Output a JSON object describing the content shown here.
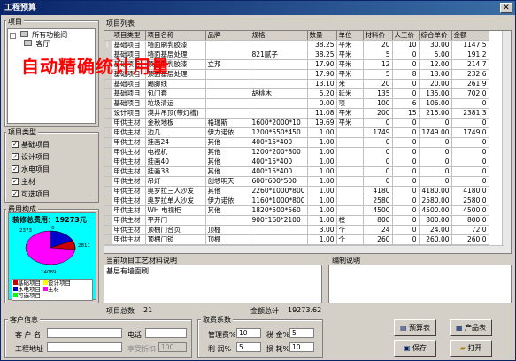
{
  "window": {
    "title": "工程预算",
    "close_glyph": "✕"
  },
  "left": {
    "tree_header": "项目",
    "tree_items": [
      "所有功能间",
      "客厅"
    ],
    "types_header": "项目类型",
    "types": [
      {
        "label": "基础项目",
        "checked": true
      },
      {
        "label": "设计项目",
        "checked": true
      },
      {
        "label": "水电项目",
        "checked": true
      },
      {
        "label": "主材",
        "checked": true
      },
      {
        "label": "可选项目",
        "checked": true
      }
    ],
    "cost_header": "费用构成",
    "total_label": "装修总费用：19273元",
    "pie_values": [
      "2373",
      "0",
      "2811",
      "14089"
    ],
    "legend": [
      "基础项目",
      "设计项目",
      "水电项目",
      "主材",
      "可选项目"
    ],
    "colors": {
      "base": "#cc0000",
      "design": "#ffff00",
      "water": "#0000cc",
      "main": "#ff00ff",
      "optional": "#00ff00"
    }
  },
  "overlay_text": "自动精确统计用量",
  "list": {
    "header": "项目列表",
    "columns": [
      "项目类型",
      "项目名称",
      "品牌",
      "规格",
      "数量",
      "单位",
      "材料价",
      "人工价",
      "综合单价",
      "金额"
    ],
    "rows": [
      [
        "基础项目",
        "墙面刷乳胶漆",
        "",
        "",
        "38.25",
        "平米",
        "20",
        "10",
        "30.00",
        "1147.5"
      ],
      [
        "基础项目",
        "墙面基层处理",
        "",
        "821腻子",
        "38.25",
        "平米",
        "5",
        "0",
        "5.00",
        "191.2"
      ],
      [
        "基础项目",
        "顶面刷乳胶漆",
        "立邦",
        "",
        "17.90",
        "平米",
        "12",
        "0",
        "12.00",
        "214.7"
      ],
      [
        "基础项目",
        "顶面基层处理",
        "",
        "",
        "17.90",
        "平米",
        "5",
        "8",
        "13.00",
        "232.6"
      ],
      [
        "基础项目",
        "踢脚线",
        "",
        "",
        "13.10",
        "米",
        "20",
        "0",
        "20.00",
        "261.9"
      ],
      [
        "基础项目",
        "包门套",
        "",
        "胡桃木",
        "5.20",
        "延米",
        "135",
        "0",
        "135.00",
        "702.0"
      ],
      [
        "基础项目",
        "垃圾清运",
        "",
        "",
        "0.00",
        "项",
        "100",
        "6",
        "106.00",
        "0"
      ],
      [
        "设计项目",
        "漠井吊顶(带灯槽)",
        "",
        "",
        "11.08",
        "平米",
        "200",
        "15",
        "215.00",
        "2381.3"
      ],
      [
        "甲供主材",
        "金秋地板",
        "格瑞斯",
        "1600*2000*10",
        "19.69",
        "平米",
        "0",
        "0",
        "0",
        "0"
      ],
      [
        "甲供主材",
        "边几",
        "伊力诺依",
        "1200*550*450",
        "1.00",
        "",
        "1749",
        "0",
        "1749.00",
        "1749.0"
      ],
      [
        "甲供主材",
        "挂画24",
        "其他",
        "400*15*400",
        "1.00",
        "",
        "0",
        "0",
        "0",
        "0"
      ],
      [
        "甲供主材",
        "电视机",
        "其他",
        "1200*200*800",
        "1.00",
        "",
        "0",
        "0",
        "0",
        "0"
      ],
      [
        "甲供主材",
        "挂画40",
        "其他",
        "400*15*400",
        "1.00",
        "",
        "0",
        "0",
        "0",
        "0"
      ],
      [
        "甲供主材",
        "挂画38",
        "其他",
        "400*15*400",
        "1.00",
        "",
        "0",
        "0",
        "0",
        "0"
      ],
      [
        "甲供主材",
        "吊灯",
        "创想明天",
        "600*600*500",
        "1.00",
        "",
        "0",
        "0",
        "0",
        "0"
      ],
      [
        "甲供主材",
        "奥罗拉三人沙发",
        "其他",
        "2260*1000*800",
        "1.00",
        "",
        "4180",
        "0",
        "4180.00",
        "4180.0"
      ],
      [
        "甲供主材",
        "奥罗拉单人沙发",
        "伊力诺依",
        "1160*1000*800",
        "1.00",
        "",
        "2580",
        "0",
        "2580.00",
        "2580.0"
      ],
      [
        "甲供主材",
        "WH 电视柜",
        "其他",
        "1820*500*560",
        "1.00",
        "",
        "4500",
        "0",
        "4500.00",
        "4500.0"
      ],
      [
        "甲供主材",
        "平开门",
        "",
        "900*160*2100",
        "1.00",
        "樘",
        "800",
        "0",
        "800.00",
        "800.0"
      ],
      [
        "甲供主材",
        "顶棚门合页",
        "顶棚",
        "",
        "3.00",
        "个",
        "24",
        "0",
        "24.00",
        "72.0"
      ],
      [
        "甲供主材",
        "顶棚门锁",
        "顶棚",
        "",
        "1.00",
        "个",
        "260",
        "0",
        "260.00",
        "260.0"
      ]
    ]
  },
  "craft": {
    "header": "当前项目工艺材料说明",
    "text": "基层有墙面刷",
    "note_header": "编制说明"
  },
  "summary": {
    "count_label": "项目总数",
    "count": "21",
    "total_label": "金额总计",
    "total": "19273.62"
  },
  "customer": {
    "header": "客户信息",
    "name_label": "客 户 名",
    "phone_label": "电话",
    "address_label": "工程地址",
    "discount_label": "享受折扣",
    "discount_value": "100"
  },
  "fees": {
    "header": "取费系数",
    "mgmt_label": "管理费%",
    "mgmt": "10",
    "tax_label": "税 金%",
    "tax": "5",
    "profit_label": "利 润%",
    "profit": "5",
    "loss_label": "损 耗%",
    "loss": "10"
  },
  "buttons": {
    "budget": "预算表",
    "product": "产品表",
    "save": "保存",
    "open": "打开"
  }
}
